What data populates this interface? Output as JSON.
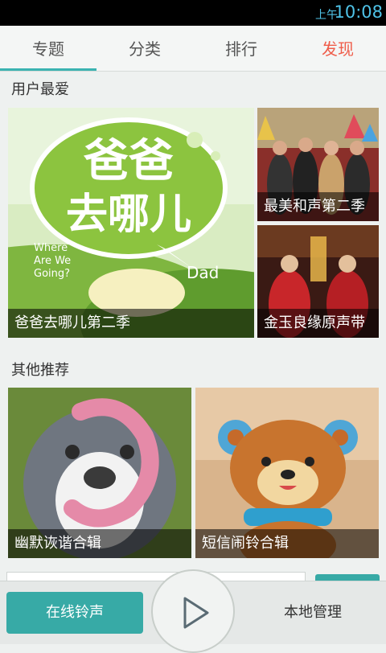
{
  "status_bar": {
    "ampm": "上午",
    "time": "10:08"
  },
  "tabs": [
    {
      "label": "专题",
      "selected": true
    },
    {
      "label": "分类",
      "selected": false
    },
    {
      "label": "排行",
      "selected": false
    },
    {
      "label": "发现",
      "selected": false
    }
  ],
  "sections": {
    "favorites": {
      "title": "用户最爱",
      "cards": [
        {
          "caption": "爸爸去哪儿第二季",
          "art_text": [
            "爸爸",
            "去哪儿",
            "Where",
            "Are We",
            "Going?",
            "Dad"
          ]
        },
        {
          "caption": "最美和声第二季"
        },
        {
          "caption": "金玉良缘原声带"
        }
      ]
    },
    "others": {
      "title": "其他推荐",
      "cards": [
        {
          "caption": "幽默诙谐合辑"
        },
        {
          "caption": "短信闹铃合辑"
        }
      ]
    }
  },
  "bottom_nav": {
    "online": "在线铃声",
    "local": "本地管理",
    "play_icon": "play-icon"
  },
  "colors": {
    "teal": "#37aaa6",
    "accent": "#ef5d4a",
    "statusbar_text": "#4fc3e8"
  }
}
